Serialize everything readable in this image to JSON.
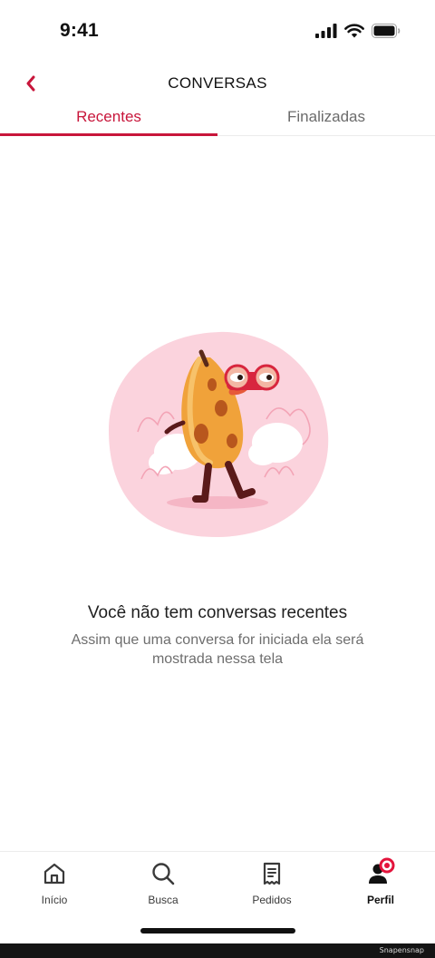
{
  "status_bar": {
    "time": "9:41"
  },
  "header": {
    "title": "CONVERSAS",
    "back_icon": "chevron-left-icon"
  },
  "tabs": [
    {
      "label": "Recentes",
      "active": true
    },
    {
      "label": "Finalizadas",
      "active": false
    }
  ],
  "empty_state": {
    "title": "Você não tem conversas recentes",
    "description": "Assim que uma conversa for iniciada ela será mostrada nessa tela"
  },
  "bottom_nav": {
    "items": [
      {
        "label": "Início",
        "icon": "home-icon",
        "active": false
      },
      {
        "label": "Busca",
        "icon": "search-icon",
        "active": false
      },
      {
        "label": "Pedidos",
        "icon": "receipt-icon",
        "active": false
      },
      {
        "label": "Perfil",
        "icon": "profile-icon",
        "active": true
      }
    ]
  },
  "watermark": "Snapensnap",
  "colors": {
    "accent": "#c8163b",
    "blob": "#fbd3dd",
    "banana": "#f0a23a"
  }
}
